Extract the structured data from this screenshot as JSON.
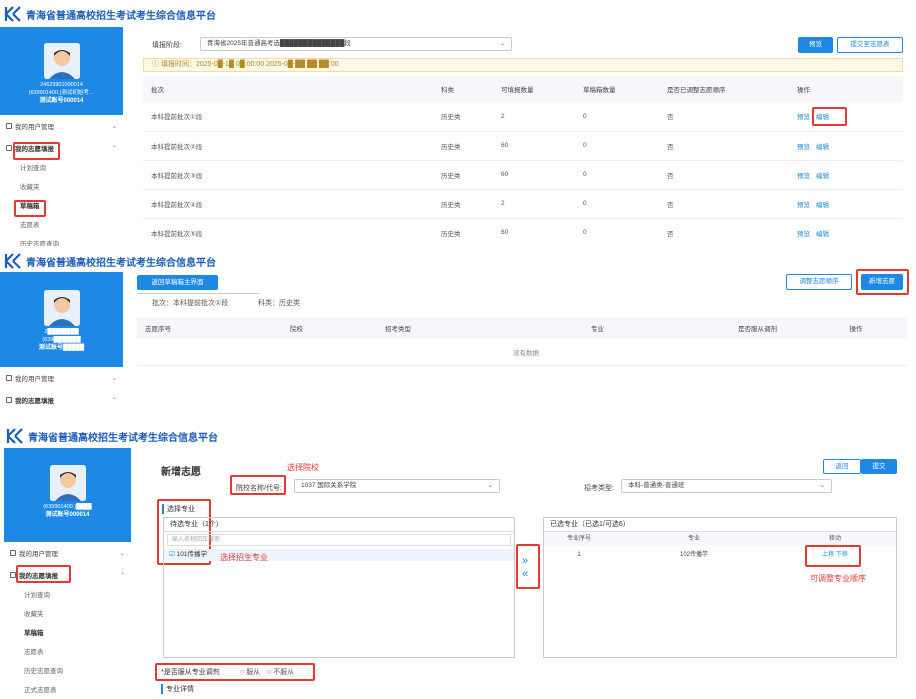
{
  "brand": {
    "title": "青海省普通高校招生考试考生综合信息平台"
  },
  "profile": {
    "id": "24629901000014",
    "name_line": "(639901400.)测试初始考…",
    "account_line": "测试账号000014",
    "id2": "2████████",
    "name_line2": "(639███████",
    "account_line2": "测试账号█████",
    "name_line3": "(639901400.)████",
    "account_line3": "测试账号000014"
  },
  "menu": {
    "user_mgmt": "我的用户管理",
    "volunteer": "我的志愿填报",
    "plan": "计划查询",
    "favorites": "收藏夹",
    "draft": "草稿箱",
    "volunteer_table": "志愿表",
    "history": "历史志愿查询",
    "more": "正式志愿表"
  },
  "p1": {
    "stage_label": "填报阶段:",
    "stage_value": "青海省2025年普通高考选██████████████段",
    "preview_btn": "预览",
    "submit_btn": "提交至志愿表",
    "notice": "填报时间：2025-0█-1█ 0█:00:00 2025-0█-██ ██:██:00",
    "headers": [
      "批次",
      "科类",
      "可填报数量",
      "草稿箱数量",
      "是否已调整志愿顺序",
      "操作"
    ],
    "rows": [
      {
        "batch": "本科提前批次①段",
        "cat": "历史类",
        "can": "2",
        "draft": "0",
        "adjusted": "否",
        "op1": "预览",
        "op2": "编辑"
      },
      {
        "batch": "本科提前批次②段",
        "cat": "历史类",
        "can": "60",
        "draft": "0",
        "adjusted": "否",
        "op1": "预览",
        "op2": "编辑"
      },
      {
        "batch": "本科提前批次③段",
        "cat": "历史类",
        "can": "60",
        "draft": "0",
        "adjusted": "否",
        "op1": "预览",
        "op2": "编辑"
      },
      {
        "batch": "本科提前批次④段",
        "cat": "历史类",
        "can": "2",
        "draft": "0",
        "adjusted": "否",
        "op1": "预览",
        "op2": "编辑"
      },
      {
        "batch": "本科提前批次⑤段",
        "cat": "历史类",
        "can": "60",
        "draft": "0",
        "adjusted": "否",
        "op1": "预览",
        "op2": "编辑"
      }
    ]
  },
  "p2": {
    "back_btn": "返回草稿箱主界面",
    "adjust_btn": "调整志愿顺序",
    "add_btn": "新增志愿",
    "batch_info": "批次：本科提前批次①段",
    "cat_info": "科类：历史类",
    "headers": [
      "志愿序号",
      "院校",
      "招考类型",
      "专业",
      "是否服从调剂",
      "操作"
    ],
    "empty": "没有数据"
  },
  "p3": {
    "title": "新增志愿",
    "back_btn": "返回",
    "submit_btn": "提交",
    "school_label": "院校名称/代号:",
    "school_value": "1037 国际关系学院",
    "type_label": "招考类型:",
    "type_value": "本科-普通类-普通班",
    "choose_major": "选择专业",
    "pending_title": "待选专业（1个）",
    "search_placeholder": "输入名称回车搜索",
    "pending_item": "101传播学",
    "selected_title": "已选专业（已选1/可选6）",
    "sel_headers": [
      "专业序号",
      "专业",
      "移动"
    ],
    "sel_row": {
      "no": "1",
      "major": "102传播学",
      "up": "上移",
      "down": "下移"
    },
    "obey_label": "*是否服从专业调剂",
    "obey_yes": "服从",
    "obey_no": "不服从",
    "next_label": "专业详情",
    "ann_school": "选择院校",
    "ann_major": "选择招生专业",
    "ann_order": "可调整专业顺序"
  }
}
